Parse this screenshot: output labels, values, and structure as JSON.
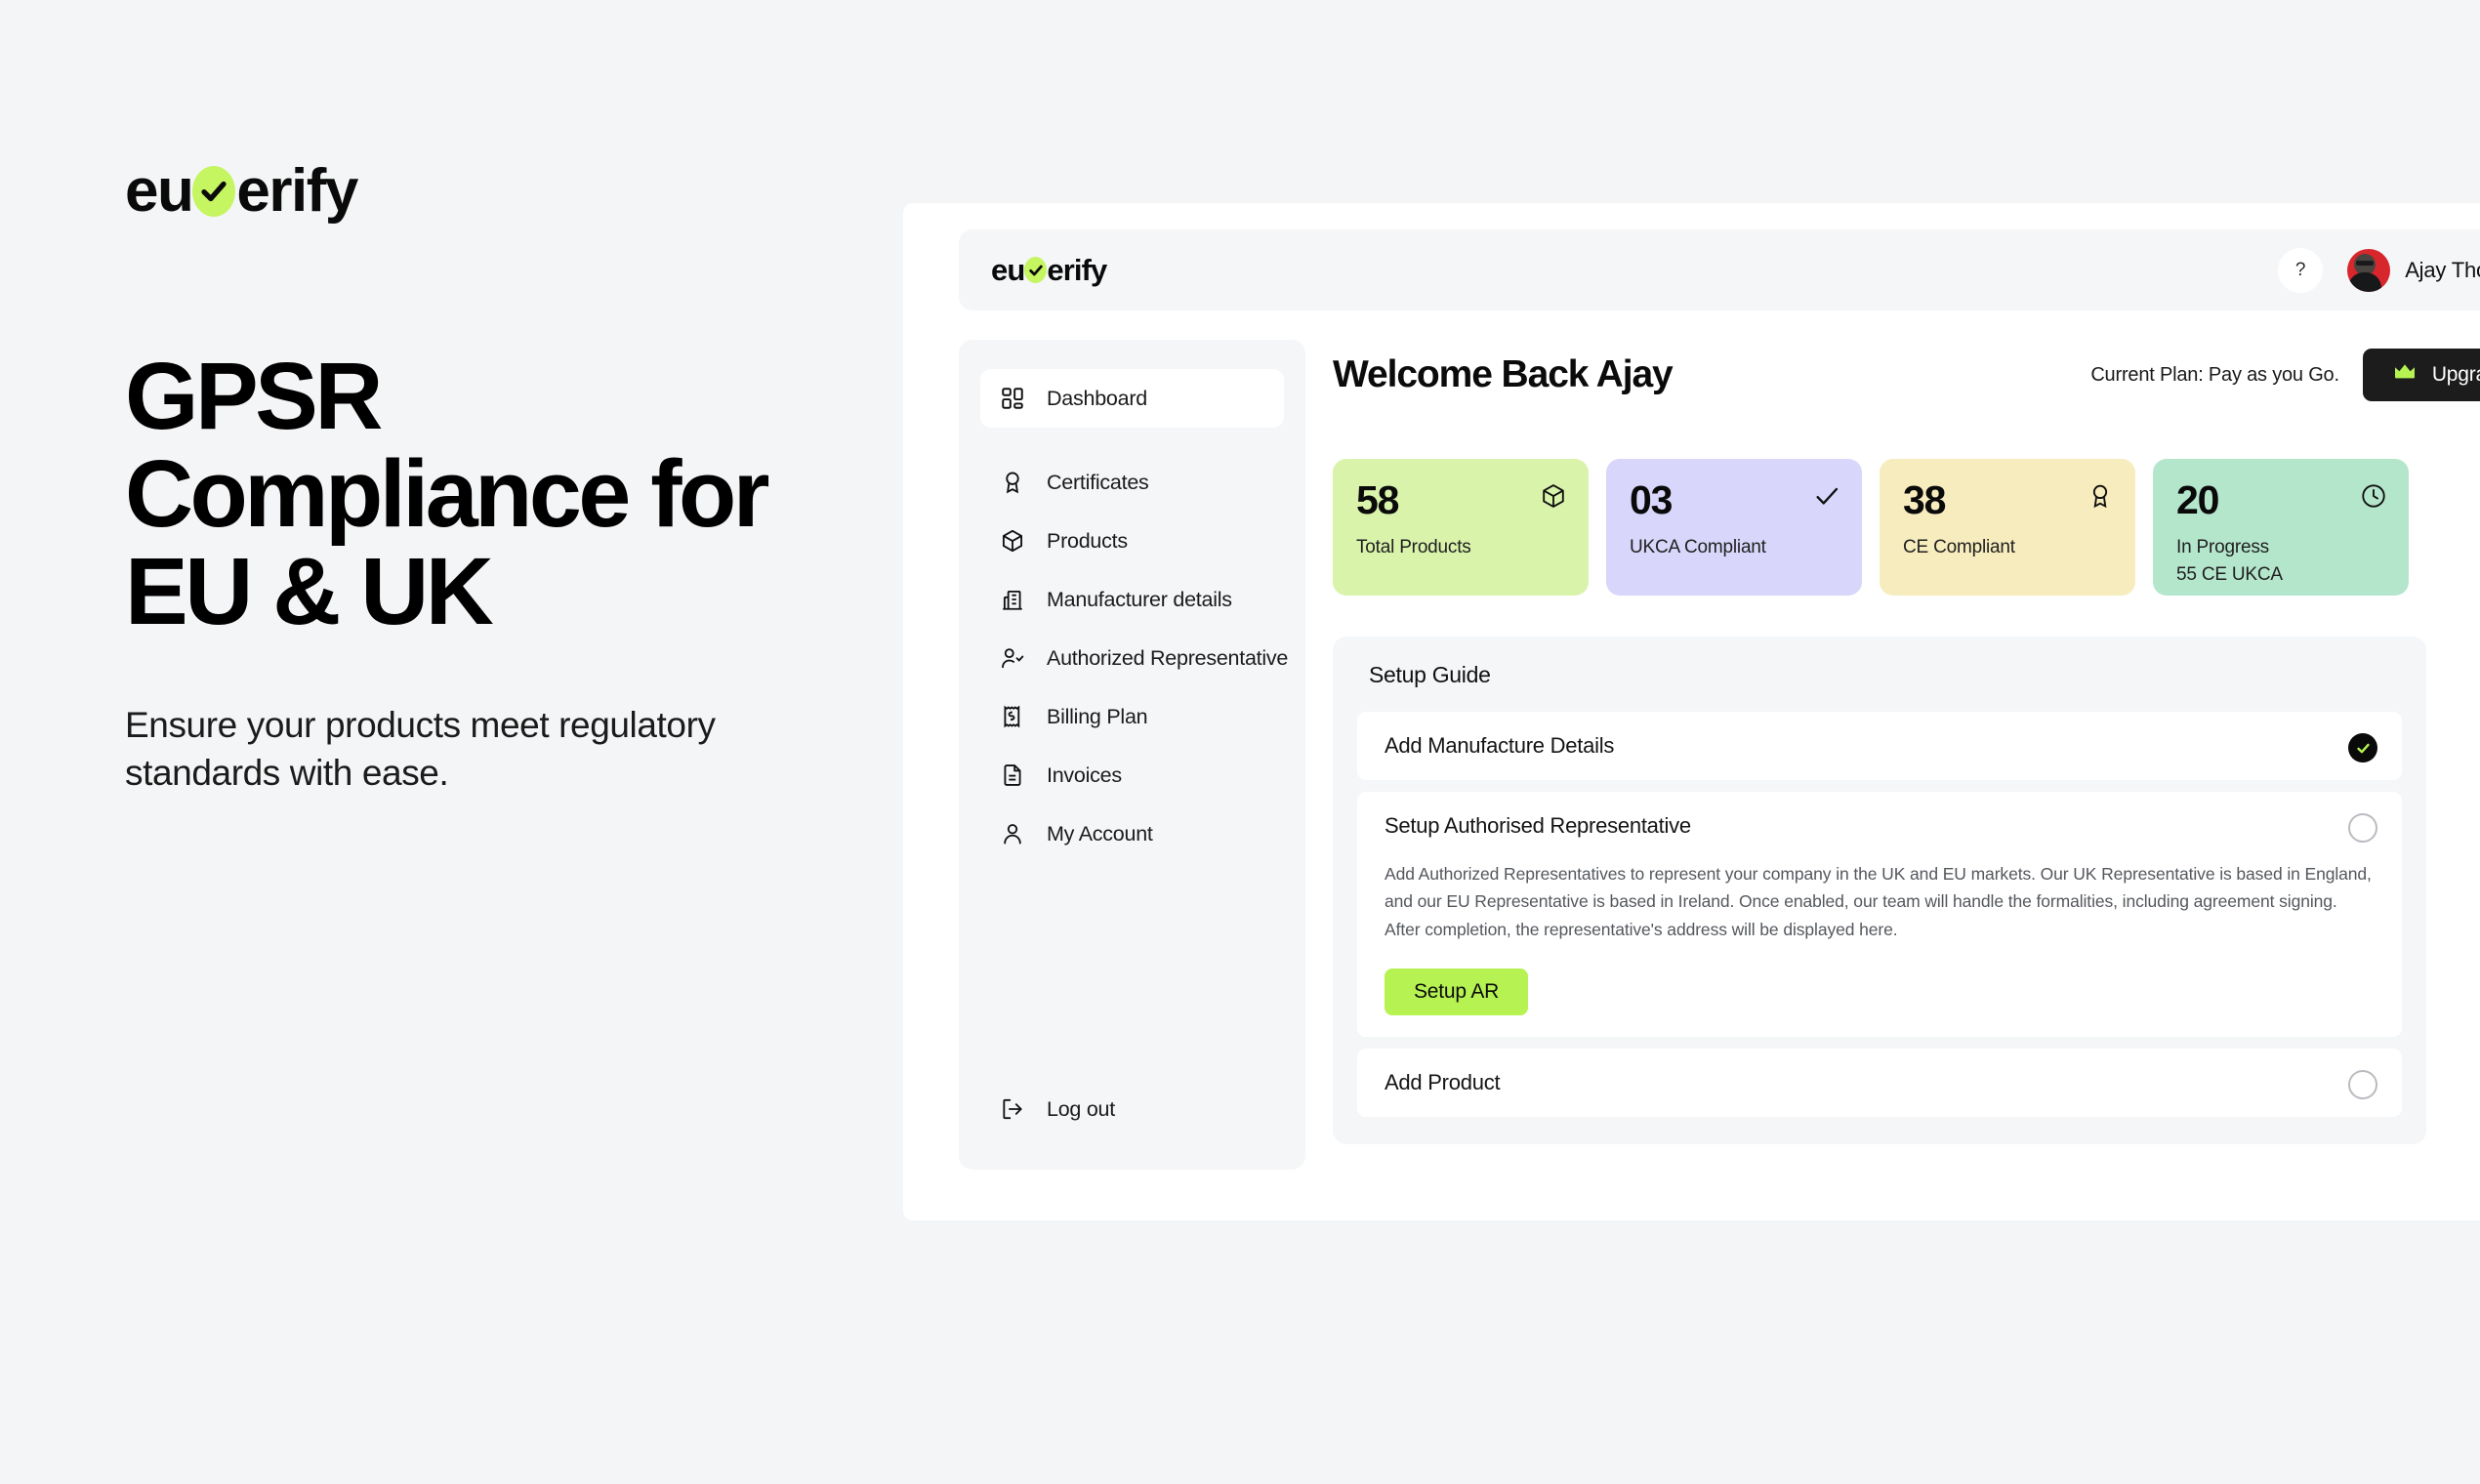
{
  "brand": {
    "name_part1": "eu",
    "name_part2": "erify",
    "check_icon": "check-icon"
  },
  "marketing": {
    "headline": "GPSR Compliance for EU & UK",
    "subhead": "Ensure your products meet regulatory standards with ease."
  },
  "header": {
    "help_label": "?",
    "user_name": "Ajay Thomas"
  },
  "sidebar": {
    "items": [
      {
        "label": "Dashboard",
        "icon": "grid-icon",
        "active": true
      },
      {
        "label": "Certificates",
        "icon": "award-icon",
        "active": false
      },
      {
        "label": "Products",
        "icon": "box-icon",
        "active": false
      },
      {
        "label": "Manufacturer details",
        "icon": "factory-icon",
        "active": false
      },
      {
        "label": "Authorized Representative",
        "icon": "user-check-icon",
        "active": false
      },
      {
        "label": "Billing Plan",
        "icon": "receipt-dollar-icon",
        "active": false
      },
      {
        "label": "Invoices",
        "icon": "file-text-icon",
        "active": false
      },
      {
        "label": "My Account",
        "icon": "user-icon",
        "active": false
      }
    ],
    "logout": {
      "label": "Log out",
      "icon": "logout-icon"
    }
  },
  "main": {
    "welcome_title": "Welcome Back Ajay",
    "plan_text": "Current Plan: Pay as you Go.",
    "upgrade_label": "Upgrade",
    "upgrade_icon": "crown-icon",
    "stats": [
      {
        "value": "58",
        "label": "Total Products",
        "sub": "",
        "color": "#d9f3ab",
        "icon": "box-icon"
      },
      {
        "value": "03",
        "label": "UKCA Compliant",
        "sub": "",
        "color": "#d8d6fa",
        "icon": "check-icon"
      },
      {
        "value": "38",
        "label": "CE Compliant",
        "sub": "",
        "color": "#f7ecbd",
        "icon": "award-icon"
      },
      {
        "value": "20",
        "label": "In Progress",
        "sub": "55 CE UKCA",
        "color": "#b4e6cc",
        "icon": "clock-icon"
      }
    ],
    "setup_guide": {
      "title": "Setup Guide",
      "steps": [
        {
          "title": "Add Manufacture  Details",
          "status": "done"
        },
        {
          "title": "Setup Authorised Representative",
          "status": "todo",
          "description": "Add Authorized Representatives to represent your company in the UK and EU markets. Our UK Representative is based in England, and our EU Representative is based in Ireland. Once enabled, our team will handle the formalities, including agreement signing. After completion, the representative's address will be displayed here.",
          "action_label": "Setup AR"
        },
        {
          "title": "Add Product",
          "status": "todo"
        }
      ]
    }
  },
  "colors": {
    "accent_green": "#c5f560",
    "button_green": "#b6f252",
    "dark": "#1c1c1c",
    "page_bg": "#f4f5f7",
    "panel_bg": "#f4f6f8"
  }
}
